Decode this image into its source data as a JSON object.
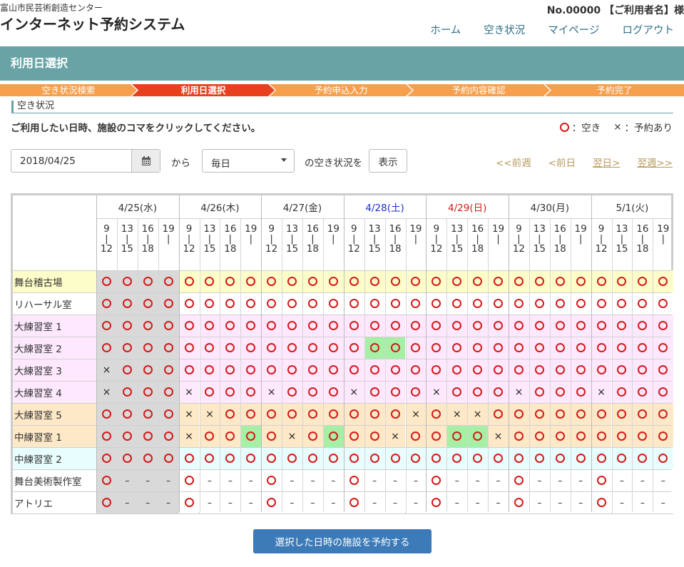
{
  "header": {
    "org": "富山市民芸術創造センター",
    "system_title": "インターネット予約システム",
    "user": "No.00000 【ご利用者名】様"
  },
  "nav": [
    "ホーム",
    "空き状況",
    "マイページ",
    "ログアウト"
  ],
  "page_title": "利用日選択",
  "steps": [
    {
      "label": "空き状況検索",
      "color": "#f6a04d"
    },
    {
      "label": "利用日選択",
      "color": "#e8401c"
    },
    {
      "label": "予約申込入力",
      "color": "#f6a04d"
    },
    {
      "label": "予約内容確認",
      "color": "#f6a04d"
    },
    {
      "label": "予約完了",
      "color": "#f6a04d"
    }
  ],
  "section_label": "空き状況",
  "instruction": "ご利用したい日時、施設のコマをクリックしてください。",
  "legend": {
    "free": "：空き",
    "booked_mark": "×",
    "booked": "：予約あり"
  },
  "controls": {
    "date": "2018/04/25",
    "from": "から",
    "frequency": "毎日",
    "suffix": "の空き状況を",
    "show_button": "表示"
  },
  "week_nav": [
    "<<前週",
    "<前日",
    "翌日>",
    "翌週>>"
  ],
  "days": [
    {
      "label": "4/25(水)",
      "color": "#333333"
    },
    {
      "label": "4/26(木)",
      "color": "#333333"
    },
    {
      "label": "4/27(金)",
      "color": "#333333"
    },
    {
      "label": "4/28(土)",
      "color": "#1a2cc8"
    },
    {
      "label": "4/29(日)",
      "color": "#d41a1a"
    },
    {
      "label": "4/30(月)",
      "color": "#333333"
    },
    {
      "label": "5/1(火)",
      "color": "#333333"
    }
  ],
  "slots": [
    {
      "start": "9",
      "end": "12"
    },
    {
      "start": "13",
      "end": "15"
    },
    {
      "start": "16",
      "end": "18"
    },
    {
      "start": "19",
      "end": ""
    }
  ],
  "colors": {
    "free_mark": "#d41a1a",
    "past_bg": "#d9d9d9",
    "selected_bg": "#a6f0a6"
  },
  "rooms": [
    {
      "name": "舞台稽古場",
      "bg": "#fdfdc9",
      "cells": [
        "o",
        "o",
        "o",
        "o",
        "o",
        "o",
        "o",
        "o",
        "o",
        "o",
        "o",
        "o",
        "o",
        "o",
        "o",
        "o",
        "o",
        "o",
        "o",
        "o",
        "o",
        "o",
        "o",
        "o",
        "o",
        "o",
        "o",
        "o"
      ]
    },
    {
      "name": "リハーサル室",
      "bg": "#ffffff",
      "cells": [
        "o",
        "o",
        "o",
        "o",
        "o",
        "o",
        "o",
        "o",
        "o",
        "o",
        "o",
        "o",
        "o",
        "o",
        "o",
        "o",
        "o",
        "o",
        "o",
        "o",
        "o",
        "o",
        "o",
        "o",
        "o",
        "o",
        "o",
        "o"
      ]
    },
    {
      "name": "大練習室 1",
      "bg": "#fde8fd",
      "cells": [
        "o",
        "o",
        "o",
        "o",
        "o",
        "o",
        "o",
        "o",
        "o",
        "o",
        "o",
        "o",
        "o",
        "o",
        "o",
        "o",
        "o",
        "o",
        "o",
        "o",
        "o",
        "o",
        "o",
        "o",
        "o",
        "o",
        "o",
        "o"
      ]
    },
    {
      "name": "大練習室 2",
      "bg": "#fde8fd",
      "cells": [
        "o",
        "o",
        "o",
        "o",
        "o",
        "o",
        "o",
        "o",
        "o",
        "o",
        "o",
        "o",
        "o",
        "O",
        "O",
        "o",
        "o",
        "o",
        "o",
        "o",
        "o",
        "o",
        "o",
        "o",
        "o",
        "o",
        "o",
        "o"
      ]
    },
    {
      "name": "大練習室 3",
      "bg": "#fde8fd",
      "cells": [
        "x",
        "o",
        "o",
        "o",
        "o",
        "o",
        "o",
        "o",
        "o",
        "o",
        "o",
        "o",
        "o",
        "o",
        "o",
        "o",
        "o",
        "o",
        "o",
        "o",
        "o",
        "o",
        "o",
        "o",
        "o",
        "o",
        "o",
        "o"
      ]
    },
    {
      "name": "大練習室 4",
      "bg": "#fde8fd",
      "cells": [
        "x",
        "o",
        "o",
        "o",
        "x",
        "o",
        "o",
        "o",
        "x",
        "o",
        "o",
        "o",
        "x",
        "o",
        "o",
        "o",
        "x",
        "o",
        "o",
        "o",
        "x",
        "o",
        "o",
        "o",
        "x",
        "o",
        "o",
        "o"
      ]
    },
    {
      "name": "大練習室 5",
      "bg": "#fde8c7",
      "cells": [
        "o",
        "o",
        "o",
        "o",
        "x",
        "x",
        "o",
        "o",
        "o",
        "o",
        "o",
        "o",
        "o",
        "o",
        "o",
        "x",
        "o",
        "x",
        "x",
        "o",
        "o",
        "o",
        "o",
        "o",
        "o",
        "o",
        "o",
        "o"
      ]
    },
    {
      "name": "中練習室 1",
      "bg": "#fde8c7",
      "cells": [
        "o",
        "o",
        "o",
        "o",
        "x",
        "o",
        "o",
        "O",
        "o",
        "x",
        "o",
        "O",
        "o",
        "o",
        "x",
        "o",
        "o",
        "O",
        "O",
        "x",
        "o",
        "o",
        "o",
        "o",
        "o",
        "o",
        "o",
        "o"
      ]
    },
    {
      "name": "中練習室 2",
      "bg": "#e8fdfd",
      "cells": [
        "o",
        "o",
        "o",
        "o",
        "o",
        "o",
        "o",
        "o",
        "o",
        "o",
        "o",
        "o",
        "o",
        "o",
        "o",
        "o",
        "o",
        "o",
        "o",
        "o",
        "o",
        "o",
        "o",
        "o",
        "o",
        "o",
        "o",
        "o"
      ]
    },
    {
      "name": "舞台美術製作室",
      "bg": "#ffffff",
      "cells": [
        "o",
        "-",
        "-",
        "-",
        "o",
        "-",
        "-",
        "-",
        "o",
        "-",
        "-",
        "-",
        "o",
        "-",
        "-",
        "-",
        "o",
        "-",
        "-",
        "-",
        "o",
        "-",
        "-",
        "-",
        "o",
        "-",
        "-",
        "-"
      ]
    },
    {
      "name": "アトリエ",
      "bg": "#ffffff",
      "cells": [
        "o",
        "-",
        "-",
        "-",
        "o",
        "-",
        "-",
        "-",
        "o",
        "-",
        "-",
        "-",
        "o",
        "-",
        "-",
        "-",
        "o",
        "-",
        "-",
        "-",
        "o",
        "-",
        "-",
        "-",
        "o",
        "-",
        "-",
        "-"
      ]
    }
  ],
  "reserve_button": "選択した日時の施設を予約する"
}
